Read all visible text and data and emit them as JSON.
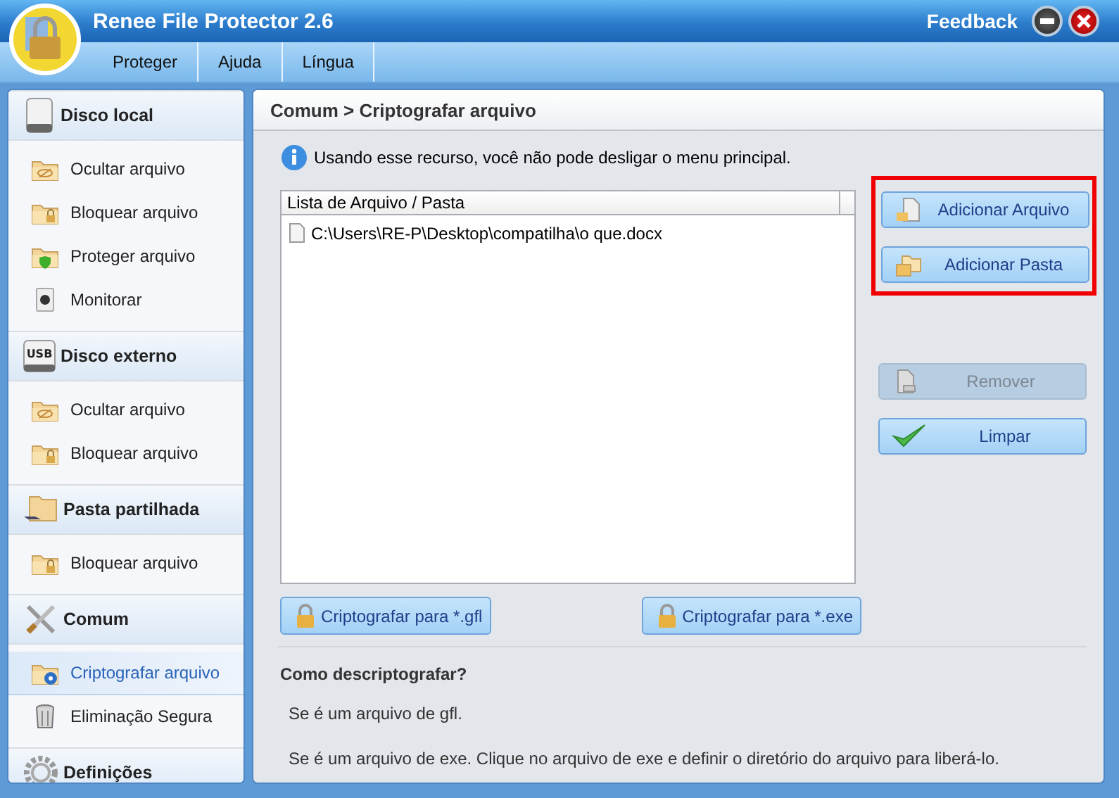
{
  "window": {
    "title": "Renee File Protector 2.6",
    "feedback": "Feedback"
  },
  "menu": [
    "Proteger",
    "Ajuda",
    "Língua"
  ],
  "sidebar": [
    {
      "title": "Disco local",
      "kind": "disk",
      "items": [
        {
          "label": "Ocultar arquivo",
          "kind": "hide",
          "selected": false
        },
        {
          "label": "Bloquear arquivo",
          "kind": "lock",
          "selected": false
        },
        {
          "label": "Proteger arquivo",
          "kind": "protect",
          "selected": false
        },
        {
          "label": "Monitorar",
          "kind": "monitor",
          "selected": false
        }
      ]
    },
    {
      "title": "Disco externo",
      "kind": "usb",
      "usb_text": "USB",
      "items": [
        {
          "label": "Ocultar arquivo",
          "kind": "hide",
          "selected": false
        },
        {
          "label": "Bloquear arquivo",
          "kind": "lock",
          "selected": false
        }
      ]
    },
    {
      "title": "Pasta partilhada",
      "kind": "share",
      "items": [
        {
          "label": "Bloquear arquivo",
          "kind": "lock",
          "selected": false
        }
      ]
    },
    {
      "title": "Comum",
      "kind": "tools",
      "items": [
        {
          "label": "Criptografar arquivo",
          "kind": "encrypt",
          "selected": true
        },
        {
          "label": "Eliminação Segura",
          "kind": "trash",
          "selected": false
        }
      ]
    },
    {
      "title": "Definições",
      "kind": "gear"
    }
  ],
  "main": {
    "breadcrumb": "Comum > Criptografar arquivo",
    "info": "Usando esse recurso, você não pode desligar o menu principal.",
    "list": {
      "column": "Lista de Arquivo / Pasta",
      "rows": [
        "C:\\Users\\RE-P\\Desktop\\compatilha\\o que.docx"
      ]
    },
    "add_actions": [
      {
        "label": "Adicionar Arquivo",
        "kind": "add-file",
        "disabled": false
      },
      {
        "label": "Adicionar Pasta",
        "kind": "add-folder",
        "disabled": false
      }
    ],
    "edit_actions": [
      {
        "label": "Remover",
        "kind": "remove",
        "disabled": true
      },
      {
        "label": "Limpar",
        "kind": "clear",
        "disabled": false
      }
    ],
    "add_highlighted": true,
    "encrypt_buttons": [
      "Criptografar para *.gfl",
      "Criptografar para *.exe"
    ],
    "help": {
      "title": "Como descriptografar?",
      "lines": [
        "Se é um arquivo de gfl.",
        "Se é um arquivo de exe. Clique no arquivo de exe e definir o diretório do arquivo para liberá-lo."
      ]
    }
  }
}
